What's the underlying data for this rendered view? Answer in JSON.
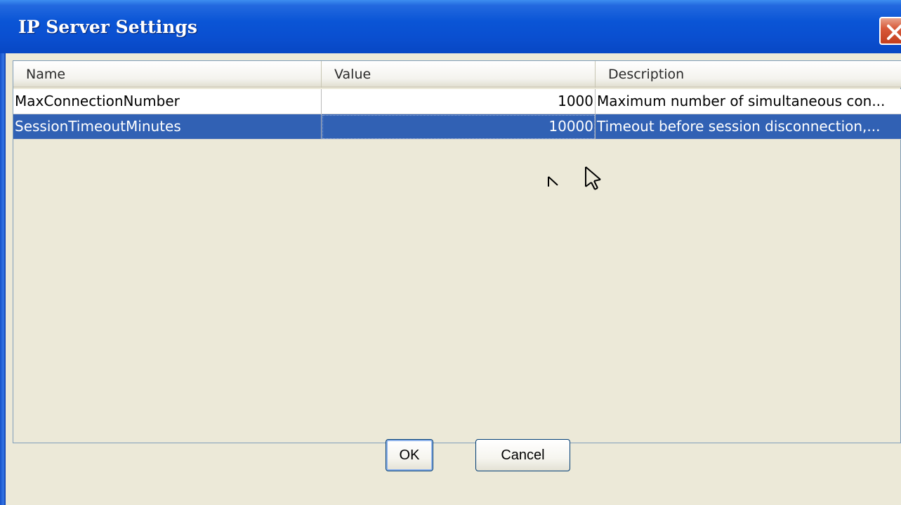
{
  "window": {
    "title": "IP Server Settings"
  },
  "table": {
    "columns": [
      "Name",
      "Value",
      "Description"
    ],
    "rows": [
      {
        "name": "MaxConnectionNumber",
        "value": "1000",
        "description": "Maximum number of simultaneous con...",
        "selected": false
      },
      {
        "name": "SessionTimeoutMinutes",
        "value": "10000",
        "description": "Timeout before session disconnection,...",
        "selected": true
      }
    ]
  },
  "buttons": {
    "ok_label": "OK",
    "cancel_label": "Cancel"
  },
  "colors": {
    "titlebar": "#0a55d6",
    "selection": "#3161b4",
    "dialog_bg": "#ece9d8"
  }
}
